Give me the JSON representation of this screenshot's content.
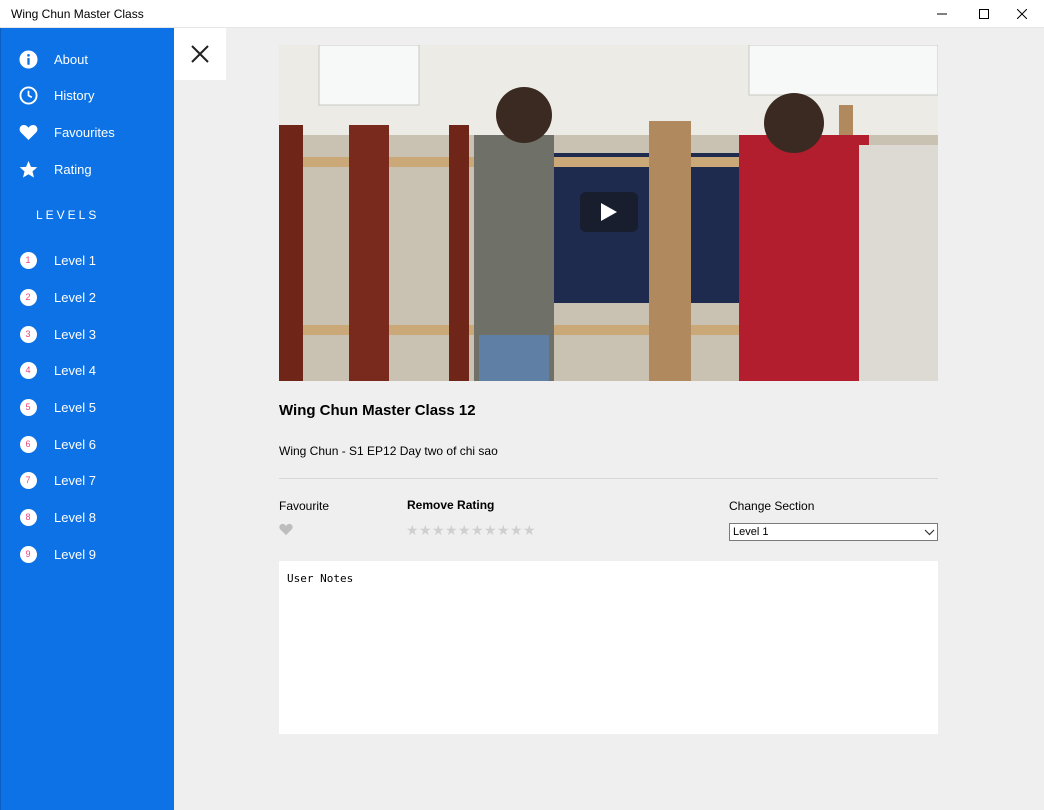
{
  "window": {
    "title": "Wing Chun Master Class"
  },
  "sidebar": {
    "items": [
      {
        "label": "About",
        "icon": "info-icon"
      },
      {
        "label": "History",
        "icon": "clock-icon"
      },
      {
        "label": "Favourites",
        "icon": "heart-icon"
      },
      {
        "label": "Rating",
        "icon": "star-icon"
      }
    ],
    "levels_header": "LEVELS",
    "levels": [
      {
        "num": "1",
        "label": "Level 1"
      },
      {
        "num": "2",
        "label": "Level 2"
      },
      {
        "num": "3",
        "label": "Level 3"
      },
      {
        "num": "4",
        "label": "Level 4"
      },
      {
        "num": "5",
        "label": "Level 5"
      },
      {
        "num": "6",
        "label": "Level 6"
      },
      {
        "num": "7",
        "label": "Level 7"
      },
      {
        "num": "8",
        "label": "Level 8"
      },
      {
        "num": "9",
        "label": "Level 9"
      }
    ]
  },
  "video": {
    "title": "Wing Chun Master Class 12",
    "description": "Wing Chun - S1 EP12 Day two of chi sao"
  },
  "controls": {
    "favourite_label": "Favourite",
    "remove_rating_label": "Remove Rating",
    "star_count": 10,
    "change_section_label": "Change Section",
    "section_selected": "Level 1"
  },
  "notes": {
    "placeholder": "User Notes"
  },
  "colors": {
    "sidebar_bg": "#0c72e6",
    "level_number": "#e8457a",
    "main_bg": "#efefef"
  }
}
